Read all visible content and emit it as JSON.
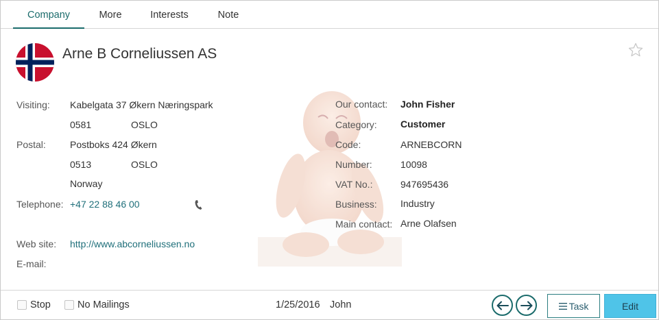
{
  "tabs": [
    {
      "label": "Company"
    },
    {
      "label": "More"
    },
    {
      "label": "Interests"
    },
    {
      "label": "Note"
    }
  ],
  "company": {
    "name": "Arne B Corneliussen AS",
    "flag_country": "Norway"
  },
  "left": {
    "visiting_label": "Visiting:",
    "visiting_street": "Kabelgata 37 Økern Næringspark",
    "visiting_zip": "0581",
    "visiting_city": "OSLO",
    "postal_label": "Postal:",
    "postal_street": "Postboks 424 Økern",
    "postal_zip": "0513",
    "postal_city": "OSLO",
    "country": "Norway",
    "telephone_label": "Telephone:",
    "telephone": "+47 22 88 46 00",
    "website_label": "Web site:",
    "website": "http://www.abcorneliussen.no",
    "email_label": "E-mail:"
  },
  "right": {
    "our_contact_label": "Our contact:",
    "our_contact": "John Fisher",
    "category_label": "Category:",
    "category": "Customer",
    "code_label": "Code:",
    "code": "ARNEBCORN",
    "number_label": "Number:",
    "number": "10098",
    "vat_label": "VAT No.:",
    "vat": "947695436",
    "business_label": "Business:",
    "business": "Industry",
    "main_contact_label": "Main contact:",
    "main_contact": "Arne Olafsen"
  },
  "footer": {
    "stop_label": "Stop",
    "no_mailings_label": "No Mailings",
    "date": "1/25/2016",
    "user": "John",
    "task_label": "Task",
    "edit_label": "Edit"
  },
  "colors": {
    "accent": "#1a6b6b",
    "link": "#1f6f7a",
    "edit_button": "#4fc4e8",
    "flag_red": "#c8102e",
    "flag_blue": "#00205b"
  },
  "icons": {
    "star": "star-outline-icon",
    "phone": "phone-icon",
    "prev": "arrow-left-icon",
    "next": "arrow-right-icon",
    "task": "list-icon"
  }
}
